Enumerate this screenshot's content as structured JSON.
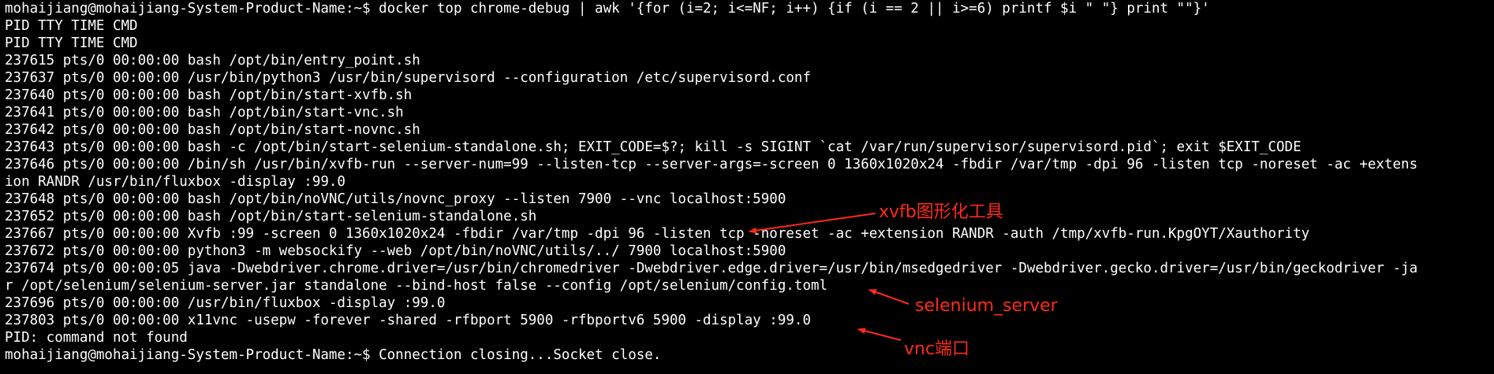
{
  "terminal": {
    "lines": [
      "mohaijiang@mohaijiang-System-Product-Name:~$ docker top chrome-debug | awk '{for (i=2; i<=NF; i++) {if (i == 2 || i>=6) printf $i \" \"} print \"\"}'",
      "PID TTY TIME CMD",
      "PID TTY TIME CMD",
      "237615 pts/0 00:00:00 bash /opt/bin/entry_point.sh",
      "237637 pts/0 00:00:00 /usr/bin/python3 /usr/bin/supervisord --configuration /etc/supervisord.conf",
      "237640 pts/0 00:00:00 bash /opt/bin/start-xvfb.sh",
      "237641 pts/0 00:00:00 bash /opt/bin/start-vnc.sh",
      "237642 pts/0 00:00:00 bash /opt/bin/start-novnc.sh",
      "237643 pts/0 00:00:00 bash -c /opt/bin/start-selenium-standalone.sh; EXIT_CODE=$?; kill -s SIGINT `cat /var/run/supervisor/supervisord.pid`; exit $EXIT_CODE",
      "237646 pts/0 00:00:00 /bin/sh /usr/bin/xvfb-run --server-num=99 --listen-tcp --server-args=-screen 0 1360x1020x24 -fbdir /var/tmp -dpi 96 -listen tcp -noreset -ac +extens",
      "ion RANDR /usr/bin/fluxbox -display :99.0",
      "237648 pts/0 00:00:00 bash /opt/bin/noVNC/utils/novnc_proxy --listen 7900 --vnc localhost:5900",
      "237652 pts/0 00:00:00 bash /opt/bin/start-selenium-standalone.sh",
      "237667 pts/0 00:00:00 Xvfb :99 -screen 0 1360x1020x24 -fbdir /var/tmp -dpi 96 -listen tcp -noreset -ac +extension RANDR -auth /tmp/xvfb-run.KpgOYT/Xauthority",
      "237672 pts/0 00:00:00 python3 -m websockify --web /opt/bin/noVNC/utils/../ 7900 localhost:5900",
      "237674 pts/0 00:00:05 java -Dwebdriver.chrome.driver=/usr/bin/chromedriver -Dwebdriver.edge.driver=/usr/bin/msedgedriver -Dwebdriver.gecko.driver=/usr/bin/geckodriver -ja",
      "r /opt/selenium/selenium-server.jar standalone --bind-host false --config /opt/selenium/config.toml",
      "237696 pts/0 00:00:00 /usr/bin/fluxbox -display :99.0",
      "237803 pts/0 00:00:00 x11vnc -usepw -forever -shared -rfbport 5900 -rfbportv6 5900 -display :99.0",
      "PID: command not found",
      "mohaijiang@mohaijiang-System-Product-Name:~$ Connection closing...Socket close."
    ]
  },
  "annotations": {
    "xvfb": "xvfb图形化工具",
    "selenium": "selenium_server",
    "vnc": "vnc端口",
    "color": "#ff2a1a"
  },
  "colors": {
    "background": "#000000",
    "text": "#ffffff",
    "annotation": "#ff2a1a"
  }
}
